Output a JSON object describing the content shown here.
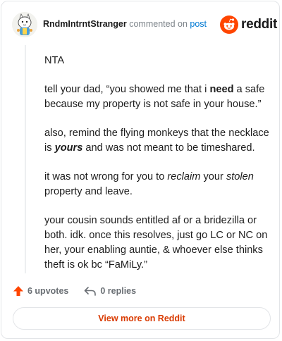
{
  "header": {
    "username": "RndmIntrntStranger",
    "action_text": "commented on",
    "post_link": "post",
    "brand": "reddit"
  },
  "comment": {
    "p1": "NTA",
    "p2_a": "tell your dad, “you showed me that i ",
    "p2_b": "need",
    "p2_c": " a safe because my property is not safe in your house.”",
    "p3_a": "also, remind the flying monkeys that the necklace is ",
    "p3_b": "yours",
    "p3_c": " and was not meant to be timeshared.",
    "p4_a": "it was not wrong for you to ",
    "p4_b": "reclaim",
    "p4_c": " your ",
    "p4_d": "stolen",
    "p4_e": " property and leave.",
    "p5": "your cousin sounds entitled af or a bridezilla or both. idk. once this resolves, just go LC or NC on her, your enabling auntie, & whoever else thinks theft is ok bc “FaMiLy.”"
  },
  "footer": {
    "upvotes": "6 upvotes",
    "replies": "0 replies",
    "view_more": "View more on Reddit"
  },
  "colors": {
    "accent": "#ff4500",
    "link": "#0079d3",
    "button_text": "#d93a00"
  }
}
